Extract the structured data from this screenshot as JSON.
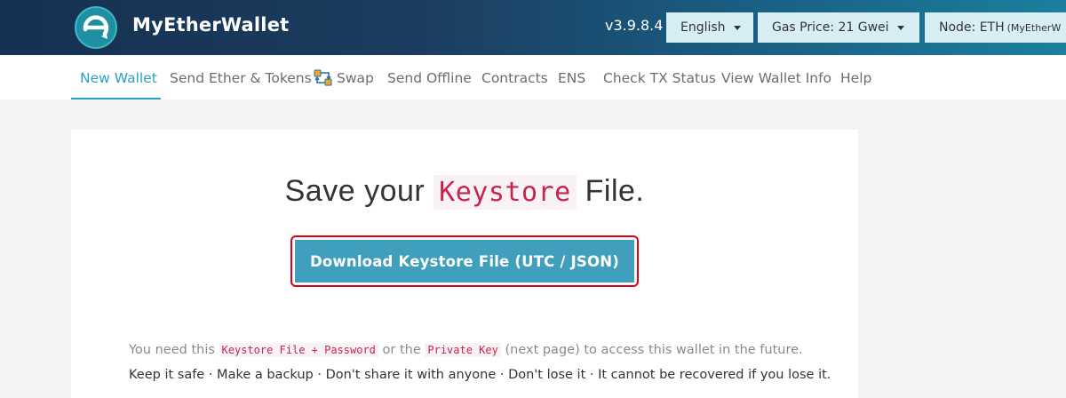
{
  "header": {
    "brand": "MyEtherWallet",
    "version": "v3.9.8.4",
    "language": "English",
    "gas_price": "Gas Price: 21 Gwei",
    "node_label": "Node: ETH",
    "node_detail": "(MyEtherW",
    "colors": {
      "bar_start": "#163151",
      "bar_end": "#1b7f9d",
      "button_bg": "#d8eef5"
    }
  },
  "nav": {
    "items": [
      {
        "label": "New Wallet",
        "active": true
      },
      {
        "label": "Send Ether & Tokens"
      },
      {
        "label": "Swap",
        "icon": "swap-icon"
      },
      {
        "label": "Send Offline"
      },
      {
        "label": "Contracts"
      },
      {
        "label": "ENS"
      },
      {
        "label": "Check TX Status"
      },
      {
        "label": "View Wallet Info"
      },
      {
        "label": "Help"
      }
    ],
    "accent": "#2aa1c0"
  },
  "card": {
    "title_pre": "Save your",
    "title_kw": "Keystore",
    "title_post": "File.",
    "download_label": "Download Keystore File (UTC / JSON)",
    "line1_a": "You need this",
    "line1_code1": "Keystore File + Password",
    "line1_b": "or the",
    "line1_code2": "Private Key",
    "line1_c": "(next page) to access this wallet in the future.",
    "line2": "Keep it safe · Make a backup · Don't share it with anyone · Don't lose it · It cannot be recovered if you lose it.",
    "button_color": "#3f9fbd",
    "highlight_color": "#e0001a"
  }
}
